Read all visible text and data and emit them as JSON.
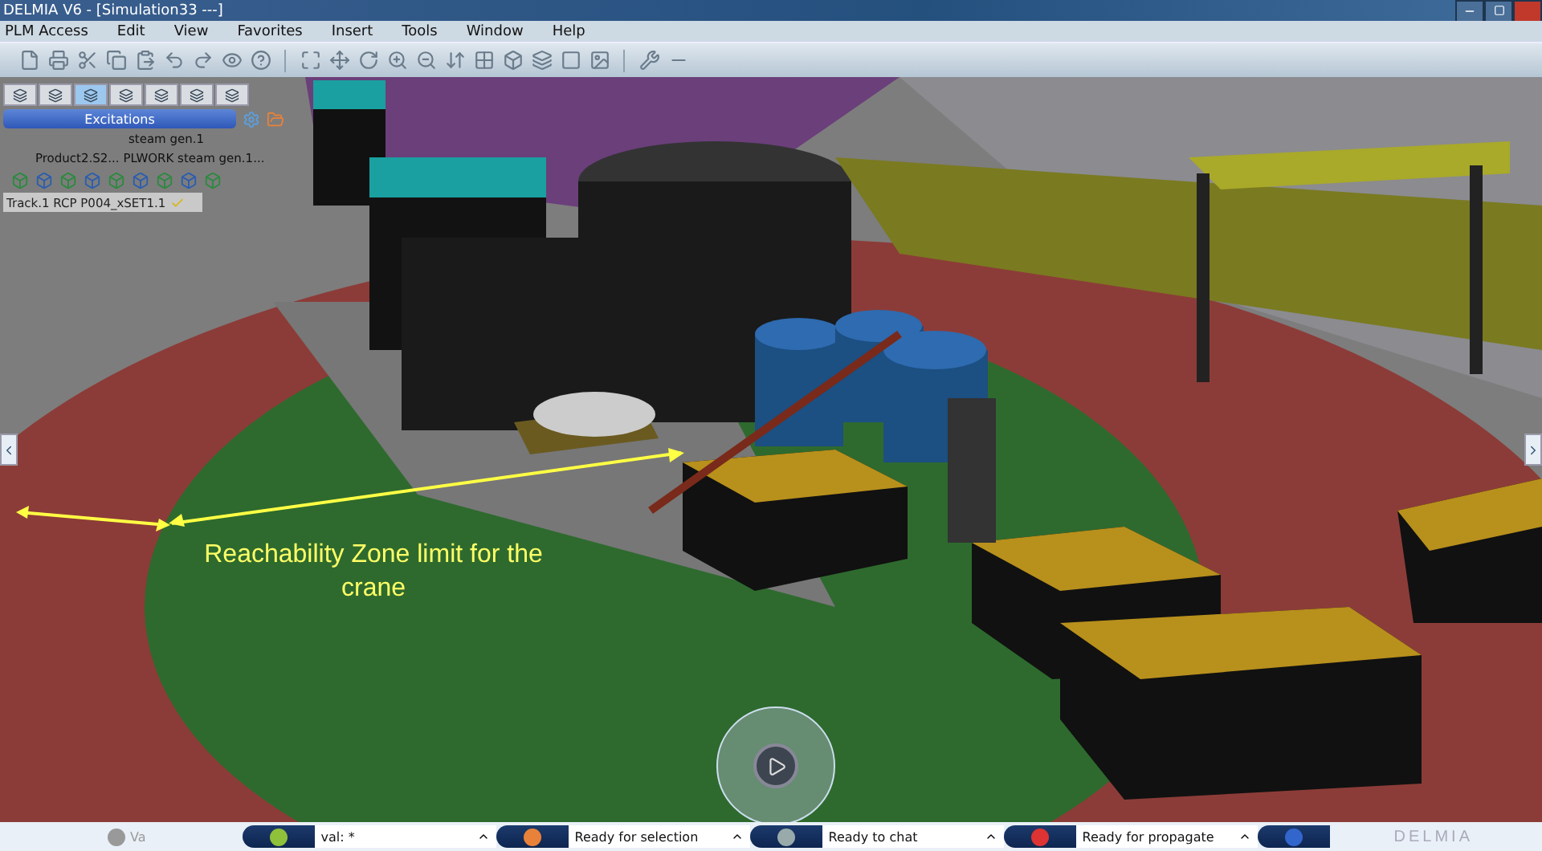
{
  "window": {
    "title": "DELMIA V6 - [Simulation33 ---]"
  },
  "menu": [
    "PLM Access",
    "Edit",
    "View",
    "Favorites",
    "Insert",
    "Tools",
    "Window",
    "Help"
  ],
  "tree": {
    "tabs": [
      {
        "selected": false
      },
      {
        "selected": false
      },
      {
        "selected": true
      },
      {
        "selected": false
      },
      {
        "selected": false
      },
      {
        "selected": false
      },
      {
        "selected": false
      }
    ],
    "header": "Excitations",
    "items": [
      "steam gen.1",
      "Product2.S2... PLWORK steam gen.1..."
    ],
    "track": "Track.1  RCP P004_xSET1.1"
  },
  "annotation": "Reachability Zone limit for the crane",
  "status_bar": {
    "small": "Va",
    "fields": [
      "val: *",
      "Ready for selection",
      "Ready to chat",
      "Ready for propagate"
    ],
    "brand": "DELMIA"
  }
}
